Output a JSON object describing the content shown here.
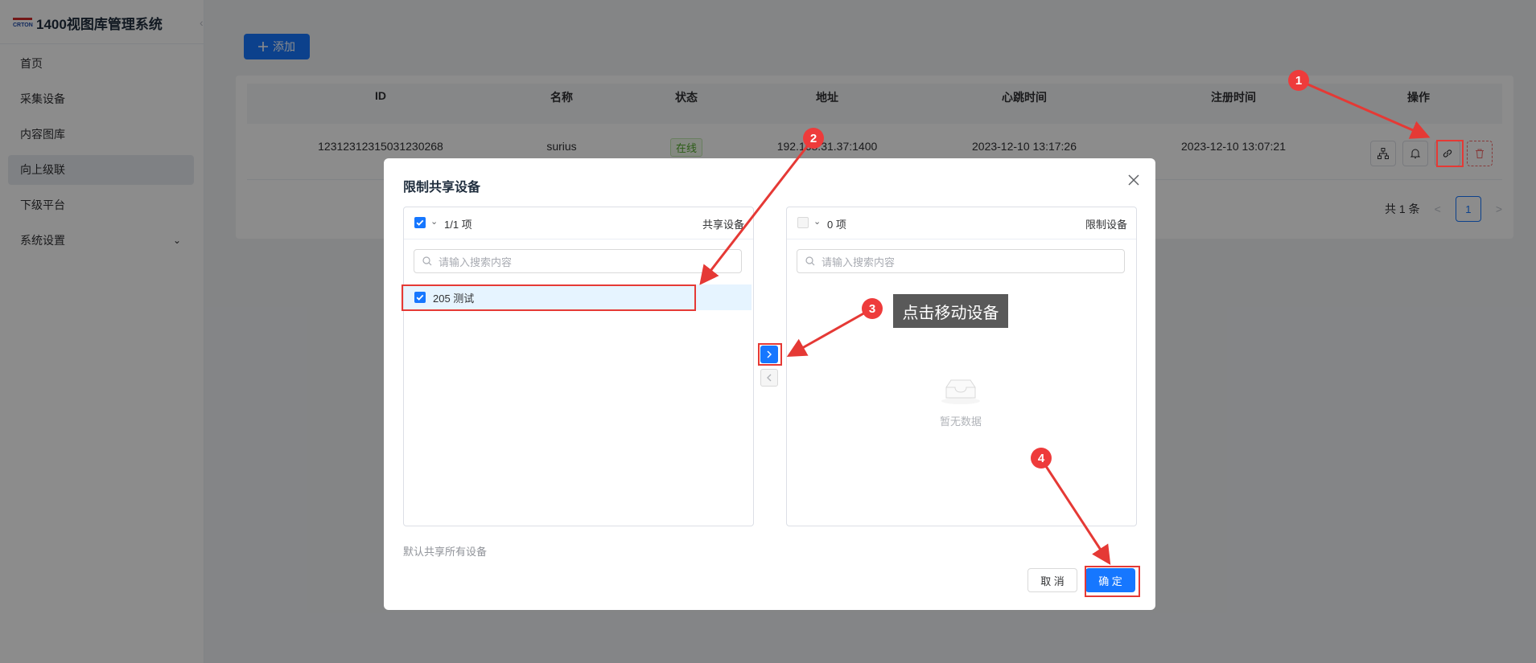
{
  "app": {
    "logo_text": "CRTON",
    "title": "1400视图库管理系统"
  },
  "sidebar": {
    "items": [
      {
        "label": "首页"
      },
      {
        "label": "采集设备"
      },
      {
        "label": "内容图库"
      },
      {
        "label": "向上级联",
        "active": true
      },
      {
        "label": "下级平台"
      },
      {
        "label": "系统设置",
        "has_submenu": true
      }
    ]
  },
  "toolbar": {
    "add_label": "添加"
  },
  "table": {
    "columns": [
      "ID",
      "名称",
      "状态",
      "地址",
      "心跳时间",
      "注册时间",
      "操作"
    ],
    "rows": [
      {
        "id": "12312312315031230268",
        "name": "surius",
        "status": "在线",
        "address": "192.168.31.37:1400",
        "heartbeat_time": "2023-12-10 13:17:26",
        "register_time": "2023-12-10 13:07:21",
        "actions": [
          "sitemap-icon",
          "bell-icon",
          "link-icon",
          "trash-icon"
        ]
      }
    ]
  },
  "pagination": {
    "total_text": "共 1 条",
    "current_page": "1"
  },
  "dialog": {
    "title": "限制共享设备",
    "left_panel": {
      "count_text": "1/1 项",
      "title": "共享设备",
      "search_placeholder": "请输入搜索内容",
      "items": [
        {
          "label": "205 测试",
          "checked": true
        }
      ]
    },
    "right_panel": {
      "count_text": "0 项",
      "title": "限制设备",
      "search_placeholder": "请输入搜索内容",
      "empty_text": "暂无数据"
    },
    "hint": "默认共享所有设备",
    "cancel_label": "取 消",
    "ok_label": "确 定"
  },
  "annotations": {
    "steps": [
      "1",
      "2",
      "3",
      "4"
    ],
    "tooltip": "点击移动设备",
    "color": "#e53935"
  },
  "colors": {
    "primary": "#1677ff",
    "danger": "#f56c6c",
    "success": "#52a92b"
  }
}
